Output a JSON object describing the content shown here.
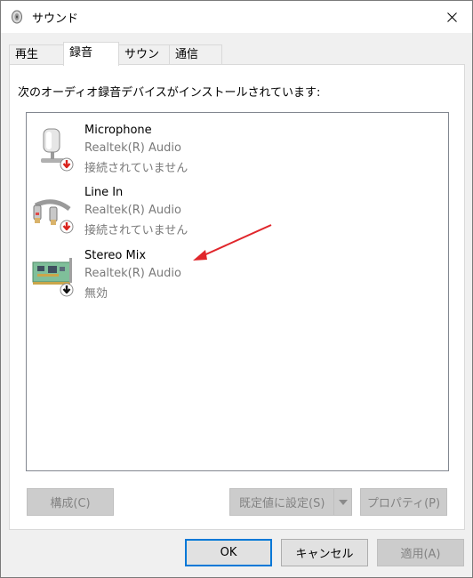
{
  "window": {
    "title": "サウンド"
  },
  "tabs": [
    {
      "label": "再生"
    },
    {
      "label": "録音"
    },
    {
      "label": "サウンド"
    },
    {
      "label": "通信"
    }
  ],
  "panel": {
    "description": "次のオーディオ録音デバイスがインストールされています:"
  },
  "devices": [
    {
      "name": "Microphone",
      "driver": "Realtek(R) Audio",
      "status": "接続されていません",
      "icon": "microphone-icon",
      "badge": "red-down-arrow"
    },
    {
      "name": "Line In",
      "driver": "Realtek(R) Audio",
      "status": "接続されていません",
      "icon": "line-in-cable-icon",
      "badge": "red-down-arrow"
    },
    {
      "name": "Stereo Mix",
      "driver": "Realtek(R) Audio",
      "status": "無効",
      "icon": "sound-card-icon",
      "badge": "black-down-arrow"
    }
  ],
  "buttons": {
    "configure": "構成(C)",
    "set_default": "既定値に設定(S)",
    "properties": "プロパティ(P)",
    "ok": "OK",
    "cancel": "キャンセル",
    "apply": "適用(A)"
  },
  "colors": {
    "accent": "#0078d7",
    "annotation_arrow": "#e0262b",
    "disabled_text": "#838383"
  }
}
